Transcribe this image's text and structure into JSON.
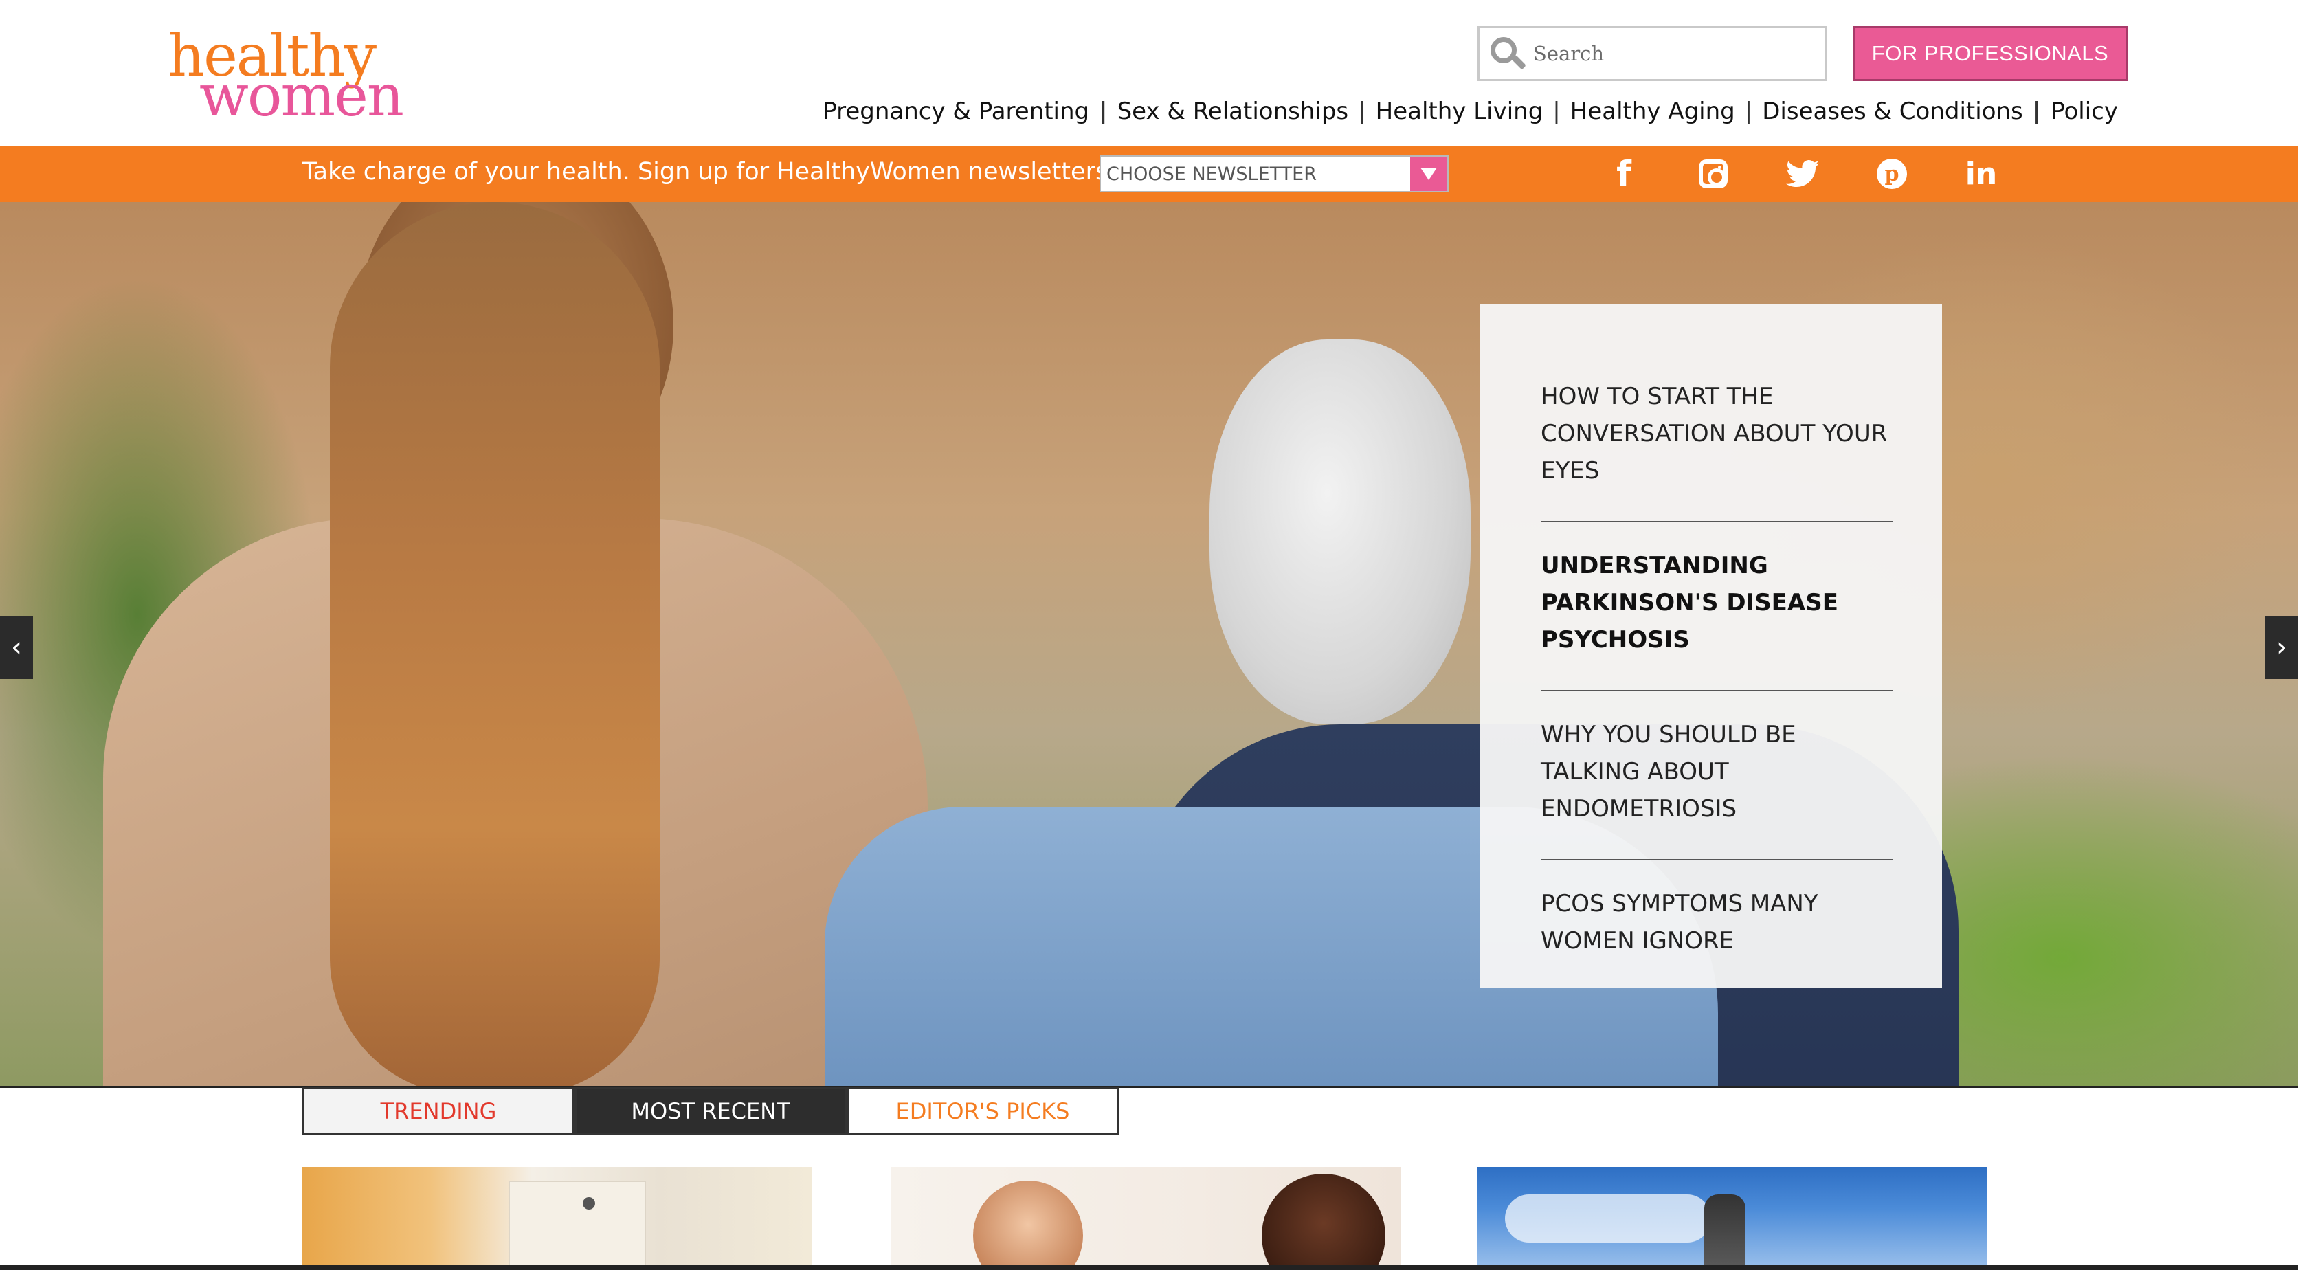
{
  "logo": {
    "line1": "healthy",
    "line2": "women"
  },
  "search": {
    "placeholder": "Search"
  },
  "header": {
    "pro_button": "FOR PROFESSIONALS"
  },
  "nav": [
    {
      "label": "Pregnancy & Parenting"
    },
    {
      "label": "Sex & Relationships"
    },
    {
      "label": "Healthy Living"
    },
    {
      "label": "Healthy Aging"
    },
    {
      "label": "Diseases & Conditions"
    },
    {
      "label": "Policy"
    }
  ],
  "nav_separators": [
    "|",
    "|",
    "|",
    "|",
    "|"
  ],
  "newsletter_bar": {
    "text": "Take charge of your health. Sign up for HealthyWomen newsletters:",
    "select_value": "CHOOSE NEWSLETTER"
  },
  "social": [
    {
      "icon": "facebook-icon",
      "glyph": "f"
    },
    {
      "icon": "instagram-icon"
    },
    {
      "icon": "twitter-icon"
    },
    {
      "icon": "pinterest-icon",
      "glyph": "p"
    },
    {
      "icon": "linkedin-icon",
      "glyph": "in"
    }
  ],
  "hero": {
    "prev_glyph": "‹",
    "next_glyph": "›",
    "stories": [
      {
        "title": "HOW TO START THE CONVERSATION ABOUT YOUR EYES",
        "active": false
      },
      {
        "title": "UNDERSTANDING PARKINSON'S DISEASE PSYCHOSIS",
        "active": true
      },
      {
        "title": "WHY YOU SHOULD BE TALKING ABOUT ENDOMETRIOSIS",
        "active": false
      },
      {
        "title": "PCOS SYMPTOMS MANY WOMEN IGNORE",
        "active": false
      }
    ]
  },
  "tabs": [
    {
      "label": "TRENDING"
    },
    {
      "label": "MOST RECENT",
      "selected": true
    },
    {
      "label": "EDITOR'S PICKS"
    }
  ],
  "colors": {
    "brand_orange": "#f47c20",
    "brand_pink": "#ea5a95",
    "trending_red": "#e2392c"
  }
}
